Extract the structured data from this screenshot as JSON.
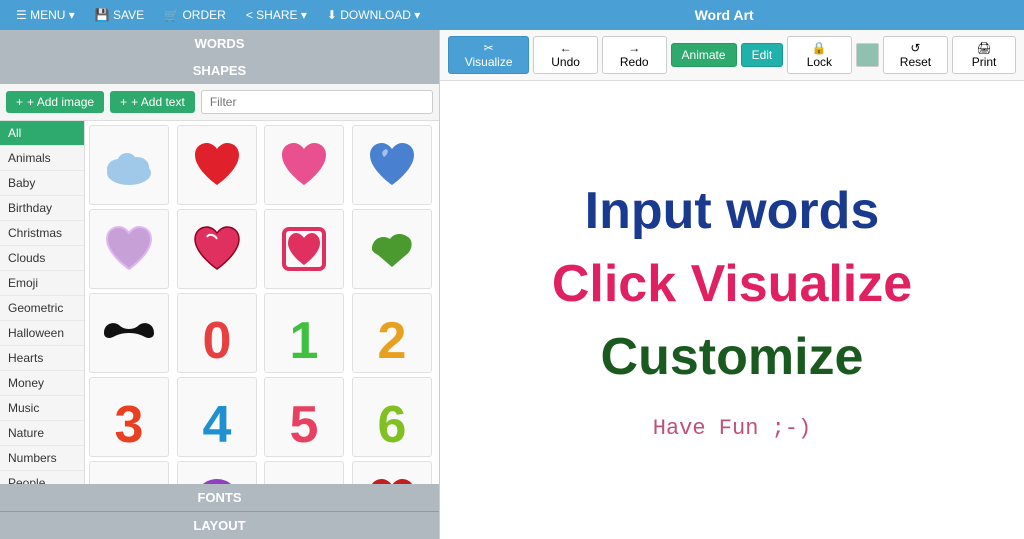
{
  "topbar": {
    "menu_label": "☰ MENU ▾",
    "save_label": "💾 SAVE",
    "order_label": "🛒 ORDER",
    "share_label": "< SHARE ▾",
    "download_label": "⬇ DOWNLOAD ▾",
    "title": "Word Art"
  },
  "left_panel": {
    "words_label": "WORDS",
    "shapes_label": "SHAPES",
    "fonts_label": "FONTS",
    "layout_label": "LAYOUT",
    "add_image_label": "+ Add image",
    "add_text_label": "+ Add text",
    "filter_placeholder": "Filter"
  },
  "categories": [
    {
      "id": "all",
      "label": "All",
      "active": true
    },
    {
      "id": "animals",
      "label": "Animals"
    },
    {
      "id": "baby",
      "label": "Baby"
    },
    {
      "id": "birthday",
      "label": "Birthday"
    },
    {
      "id": "christmas",
      "label": "Christmas"
    },
    {
      "id": "clouds",
      "label": "Clouds"
    },
    {
      "id": "emoji",
      "label": "Emoji"
    },
    {
      "id": "geometric",
      "label": "Geometric"
    },
    {
      "id": "halloween",
      "label": "Halloween"
    },
    {
      "id": "hearts",
      "label": "Hearts"
    },
    {
      "id": "money",
      "label": "Money"
    },
    {
      "id": "music",
      "label": "Music"
    },
    {
      "id": "nature",
      "label": "Nature"
    },
    {
      "id": "numbers",
      "label": "Numbers"
    },
    {
      "id": "people",
      "label": "People"
    }
  ],
  "toolbar": {
    "visualize_label": "✂ Visualize",
    "undo_label": "← Undo",
    "redo_label": "→ Redo",
    "animate_label": "Animate",
    "edit_label": "Edit",
    "lock_label": "🔒 Lock",
    "reset_label": "↺ Reset",
    "print_label": "🖨 Print",
    "swatch_color": "#90c0b0"
  },
  "canvas": {
    "line1": "Input words",
    "line2": "Click Visualize",
    "line3": "Customize",
    "line4": "Have Fun ;-)"
  }
}
